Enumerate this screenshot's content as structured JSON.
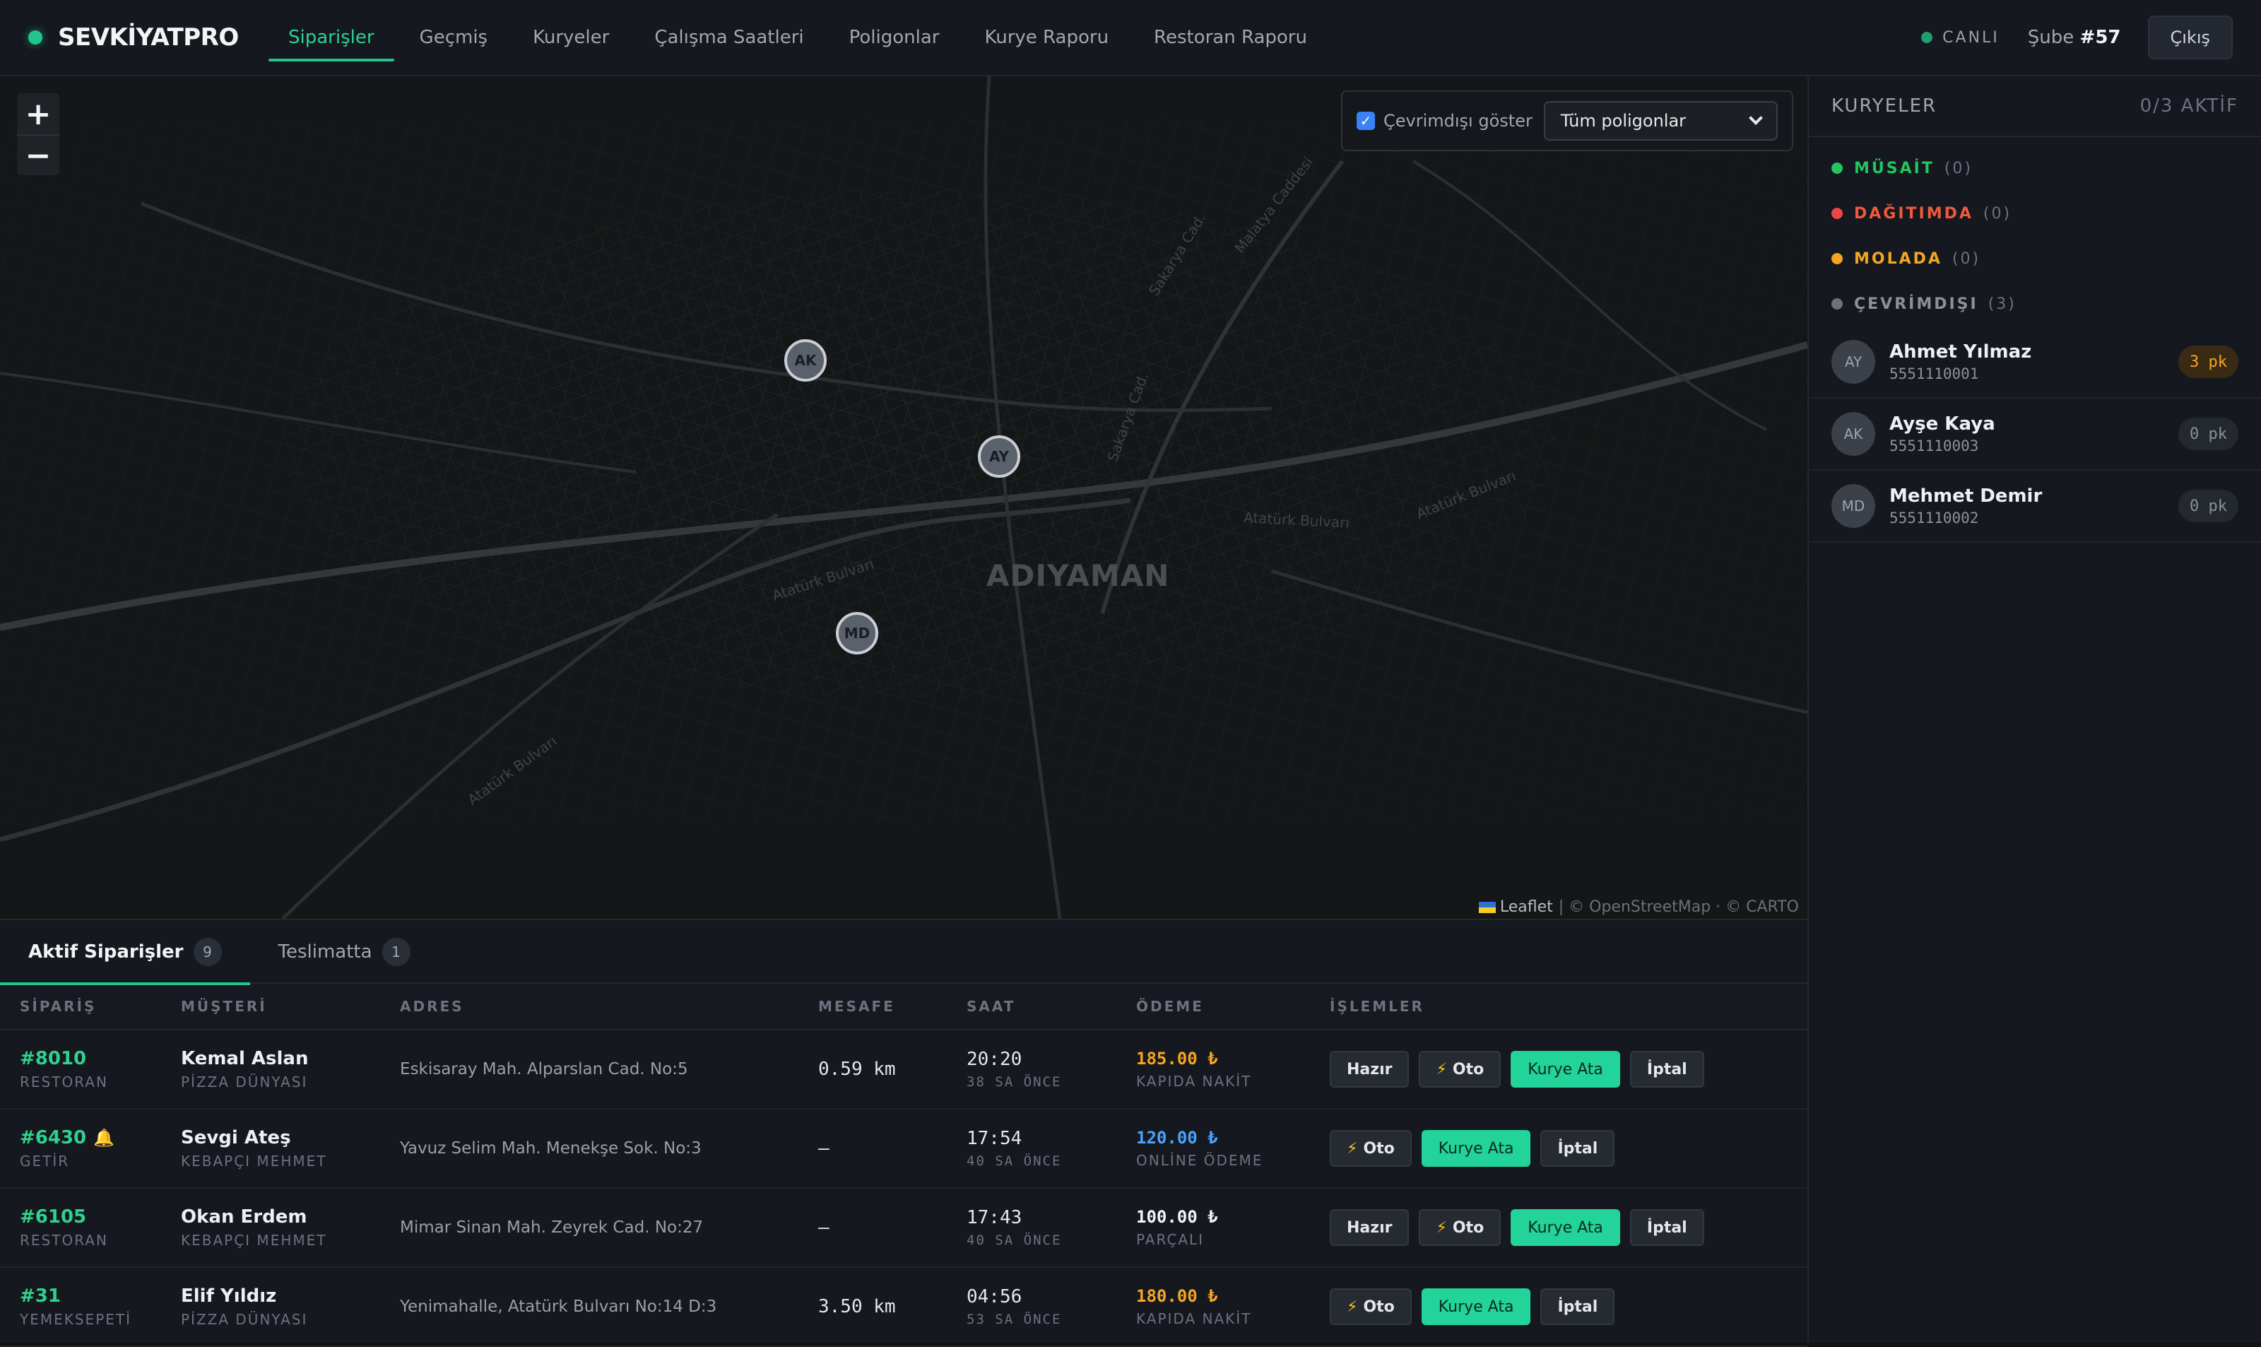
{
  "header": {
    "brand": "SEVKİYATPRO",
    "nav": [
      "Siparişler",
      "Geçmiş",
      "Kuryeler",
      "Çalışma Saatleri",
      "Poligonlar",
      "Kurye Raporu",
      "Restoran Raporu"
    ],
    "live_label": "CANLI",
    "branch_prefix": "Şube",
    "branch_number": "#57",
    "logout_label": "Çıkış"
  },
  "map": {
    "zoom_in": "+",
    "zoom_out": "−",
    "show_offline_label": "Çevrimdışı göster",
    "show_offline_checked": true,
    "polygon_select_value": "Tüm poligonlar",
    "city_label": "ADIYAMAN",
    "road_labels": [
      "Atatürk Bulvarı",
      "Atatürk Bulvarı",
      "Atatürk Bulvarı",
      "Atatürk Bulvarı",
      "Sakarya Cad.",
      "Sakarya Cad.",
      "Malatya Caddesi"
    ],
    "markers": [
      "AK",
      "AY",
      "MD"
    ],
    "attribution_leaflet": "Leaflet",
    "attribution_rest": "| © OpenStreetMap · © CARTO"
  },
  "sidebar": {
    "title": "KURYELER",
    "active_count": "0/3 AKTİF",
    "statuses": [
      {
        "label": "MÜSAİT",
        "count": "(0)",
        "color": "#22c55e"
      },
      {
        "label": "DAĞITIMDA",
        "count": "(0)",
        "color": "#ef4444"
      },
      {
        "label": "MOLADA",
        "count": "(0)",
        "color": "#f5a524"
      },
      {
        "label": "ÇEVRİMDIŞI",
        "count": "(3)",
        "color": "#6b7280"
      }
    ],
    "couriers": [
      {
        "initials": "AY",
        "name": "Ahmet Yılmaz",
        "phone": "5551110001",
        "packages": "3 pk"
      },
      {
        "initials": "AK",
        "name": "Ayşe Kaya",
        "phone": "5551110003",
        "packages": "0 pk"
      },
      {
        "initials": "MD",
        "name": "Mehmet Demir",
        "phone": "5551110002",
        "packages": "0 pk"
      }
    ]
  },
  "orders": {
    "tabs": [
      {
        "label": "Aktif Siparişler",
        "count": "9"
      },
      {
        "label": "Teslimatta",
        "count": "1"
      }
    ],
    "columns": [
      "SİPARİŞ",
      "MÜŞTERİ",
      "ADRES",
      "MESAFE",
      "SAAT",
      "ÖDEME",
      "İŞLEMLER"
    ],
    "rows": [
      {
        "id": "#8010",
        "source": "RESTORAN",
        "customer": "Kemal Aslan",
        "restaurant": "PİZZA DÜNYASI",
        "address": "Eskisaray Mah. Alparslan Cad. No:5",
        "distance": "0.59 km",
        "time": "20:20",
        "ago": "38 SA ÖNCE",
        "amount": "185.00 ₺",
        "method": "KAPIDA NAKİT"
      },
      {
        "id": "#6430",
        "source": "GETİR",
        "customer": "Sevgi Ateş",
        "restaurant": "KEBAPÇI MEHMET",
        "address": "Yavuz Selim Mah. Menekşe Sok. No:3",
        "distance": "—",
        "time": "17:54",
        "ago": "40 SA ÖNCE",
        "amount": "120.00 ₺",
        "method": "ONLİNE ÖDEME"
      },
      {
        "id": "#6105",
        "source": "RESTORAN",
        "customer": "Okan Erdem",
        "restaurant": "KEBAPÇI MEHMET",
        "address": "Mimar Sinan Mah. Zeyrek Cad. No:27",
        "distance": "—",
        "time": "17:43",
        "ago": "40 SA ÖNCE",
        "amount": "100.00 ₺",
        "method": "PARÇALI"
      },
      {
        "id": "#31",
        "source": "YEMEKSEPETİ",
        "customer": "Elif Yıldız",
        "restaurant": "PİZZA DÜNYASI",
        "address": "Yenimahalle, Atatürk Bulvarı No:14 D:3",
        "distance": "3.50 km",
        "time": "04:56",
        "ago": "53 SA ÖNCE",
        "amount": "180.00 ₺",
        "method": "KAPIDA NAKİT"
      }
    ],
    "actions": {
      "ready": "Hazır",
      "auto": "Oto",
      "assign": "Kurye Ata",
      "cancel": "İptal"
    }
  }
}
